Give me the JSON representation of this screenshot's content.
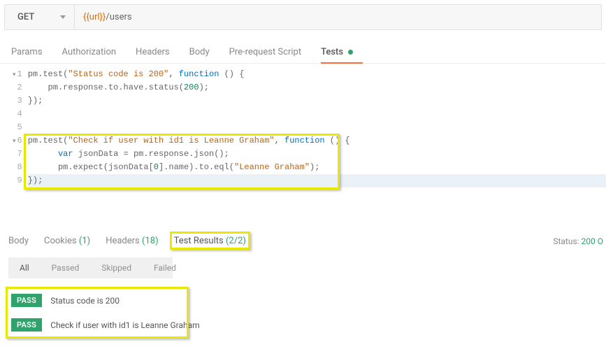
{
  "request": {
    "method": "GET",
    "url_var": "{{url}}",
    "url_path": "/users"
  },
  "tabs": {
    "params": "Params",
    "auth": "Authorization",
    "headers": "Headers",
    "body": "Body",
    "prereq": "Pre-request Script",
    "tests": "Tests"
  },
  "code": {
    "lines": [
      "pm.test(\"Status code is 200\", function () {",
      "    pm.response.to.have.status(200);",
      "});",
      "",
      "",
      "pm.test(\"Check if user with id1 is Leanne Graham\", function () {",
      "      var jsonData = pm.response.json();",
      "      pm.expect(jsonData[0].name).to.eql(\"Leanne Graham\");",
      "});"
    ]
  },
  "lower_tabs": {
    "body": "Body",
    "cookies": "Cookies",
    "cookies_count": "(1)",
    "headers": "Headers",
    "headers_count": "(18)",
    "test_results": "Test Results",
    "test_results_count": "(2/2)"
  },
  "status": {
    "label": "Status:",
    "value": "200 O"
  },
  "filters": {
    "all": "All",
    "passed": "Passed",
    "skipped": "Skipped",
    "failed": "Failed"
  },
  "results": {
    "pass_label": "PASS",
    "items": [
      "Status code is 200",
      "Check if user with id1 is Leanne Graham"
    ]
  }
}
